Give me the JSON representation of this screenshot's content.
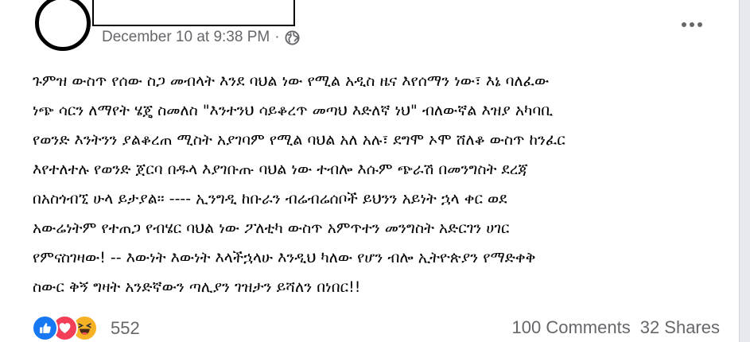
{
  "post": {
    "timestamp": "December 10 at 9:38 PM",
    "separator": "·",
    "privacy_icon": "globe-icon",
    "more_icon": "more-options-icon",
    "text_lines": [
      "ጉምዝ ውስጥ የሰው ስጋ መብላት እንደ ባህል ነው የሚል አዲስ ዜና እየሰማን ነው፣ እኔ ባለፈው",
      "ነጭ ሳርን ለማየት ሄጄ ስመለስ \"እንተንህ ሳይቆረጥ መጣህ እድለኛ ነህ\" ብለውኛል እዝያ አካባቢ",
      "የወንድ እንትንን ያልቆረጠ ሚስት አያገባም የሚል ባህል አለ አሉ፣ ደግሞ ኦሞ ሸለቆ ውስጥ ከንፈር",
      "እየተለተሉ የወንድ ጀርባ በዱላ እያገቡጡ ባህል ነው ተብሎ እሱም ጭራሽ በመንግስት ደረጃ",
      "በአስጎብኚ ሁላ ይታያል። ---- ኢንግዲ ከቡራን ብሬብሬሰቦች ይህንን አይነት ኋላ ቀር ወደ",
      "አውሬነትም የተጠጋ የብሄር ባህል ነው ፖለቲካ ውስጥ አምጥተን መንግስት አድርገን ሀገር",
      "የምናስገዛው! -- እውነት እውነት እላችኋላሁ እንዲህ ካለው የሆን ብሎ ኢትዮጵያን የማድቀቅ",
      "ስውር ቅኝ ግዛት አንድኛውን ጣሊያን ገዝታን ይሻለን በነበር!!"
    ]
  },
  "reactions": {
    "icons": [
      "like-icon",
      "love-icon",
      "haha-icon"
    ],
    "colors": {
      "like": "#1877f2",
      "love": "#f33e58",
      "haha": "#f7b125"
    },
    "count": "552"
  },
  "stats": {
    "comments": "100 Comments",
    "shares": "32 Shares"
  }
}
